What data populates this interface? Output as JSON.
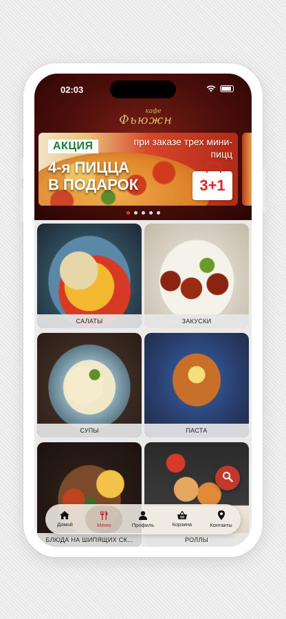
{
  "status_bar": {
    "time": "02:03"
  },
  "brand": {
    "small": "кафе",
    "name": "Фьюжн"
  },
  "banner": {
    "tag": "АКЦИЯ",
    "subtitle": "при заказе трех мини-пицц",
    "headline_line1": "4-я ПИЦЦА",
    "headline_line2": "В ПОДАРОК",
    "badge": "3+1",
    "slides_total": 5,
    "active_slide": 1
  },
  "categories": [
    {
      "label": "САЛАТЫ"
    },
    {
      "label": "ЗАКУСКИ"
    },
    {
      "label": "СУПЫ"
    },
    {
      "label": "ПАСТА"
    },
    {
      "label": "БЛЮДА НА ШИПЯЩИХ СК..."
    },
    {
      "label": "РОЛЛЫ"
    }
  ],
  "tabbar": {
    "items": [
      {
        "label": "Домой",
        "icon": "home-icon"
      },
      {
        "label": "Меню",
        "icon": "fork-knife-icon",
        "active": true
      },
      {
        "label": "Профиль",
        "icon": "user-icon"
      },
      {
        "label": "Корзина",
        "icon": "basket-icon"
      },
      {
        "label": "Контакты",
        "icon": "location-pin-icon"
      }
    ]
  },
  "colors": {
    "accent": "#c0392b",
    "header_bg": "#4a0e0a",
    "active_tab": "#b52b2b"
  }
}
